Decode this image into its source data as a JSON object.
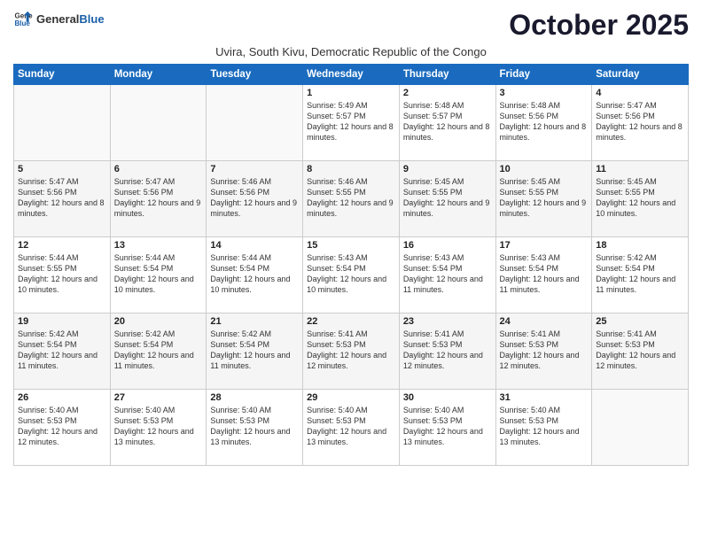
{
  "logo": {
    "general": "General",
    "blue": "Blue"
  },
  "title": "October 2025",
  "subtitle": "Uvira, South Kivu, Democratic Republic of the Congo",
  "headers": [
    "Sunday",
    "Monday",
    "Tuesday",
    "Wednesday",
    "Thursday",
    "Friday",
    "Saturday"
  ],
  "weeks": [
    [
      {
        "day": "",
        "sunrise": "",
        "sunset": "",
        "daylight": ""
      },
      {
        "day": "",
        "sunrise": "",
        "sunset": "",
        "daylight": ""
      },
      {
        "day": "",
        "sunrise": "",
        "sunset": "",
        "daylight": ""
      },
      {
        "day": "1",
        "sunrise": "Sunrise: 5:49 AM",
        "sunset": "Sunset: 5:57 PM",
        "daylight": "Daylight: 12 hours and 8 minutes."
      },
      {
        "day": "2",
        "sunrise": "Sunrise: 5:48 AM",
        "sunset": "Sunset: 5:57 PM",
        "daylight": "Daylight: 12 hours and 8 minutes."
      },
      {
        "day": "3",
        "sunrise": "Sunrise: 5:48 AM",
        "sunset": "Sunset: 5:56 PM",
        "daylight": "Daylight: 12 hours and 8 minutes."
      },
      {
        "day": "4",
        "sunrise": "Sunrise: 5:47 AM",
        "sunset": "Sunset: 5:56 PM",
        "daylight": "Daylight: 12 hours and 8 minutes."
      }
    ],
    [
      {
        "day": "5",
        "sunrise": "Sunrise: 5:47 AM",
        "sunset": "Sunset: 5:56 PM",
        "daylight": "Daylight: 12 hours and 8 minutes."
      },
      {
        "day": "6",
        "sunrise": "Sunrise: 5:47 AM",
        "sunset": "Sunset: 5:56 PM",
        "daylight": "Daylight: 12 hours and 9 minutes."
      },
      {
        "day": "7",
        "sunrise": "Sunrise: 5:46 AM",
        "sunset": "Sunset: 5:56 PM",
        "daylight": "Daylight: 12 hours and 9 minutes."
      },
      {
        "day": "8",
        "sunrise": "Sunrise: 5:46 AM",
        "sunset": "Sunset: 5:55 PM",
        "daylight": "Daylight: 12 hours and 9 minutes."
      },
      {
        "day": "9",
        "sunrise": "Sunrise: 5:45 AM",
        "sunset": "Sunset: 5:55 PM",
        "daylight": "Daylight: 12 hours and 9 minutes."
      },
      {
        "day": "10",
        "sunrise": "Sunrise: 5:45 AM",
        "sunset": "Sunset: 5:55 PM",
        "daylight": "Daylight: 12 hours and 9 minutes."
      },
      {
        "day": "11",
        "sunrise": "Sunrise: 5:45 AM",
        "sunset": "Sunset: 5:55 PM",
        "daylight": "Daylight: 12 hours and 10 minutes."
      }
    ],
    [
      {
        "day": "12",
        "sunrise": "Sunrise: 5:44 AM",
        "sunset": "Sunset: 5:55 PM",
        "daylight": "Daylight: 12 hours and 10 minutes."
      },
      {
        "day": "13",
        "sunrise": "Sunrise: 5:44 AM",
        "sunset": "Sunset: 5:54 PM",
        "daylight": "Daylight: 12 hours and 10 minutes."
      },
      {
        "day": "14",
        "sunrise": "Sunrise: 5:44 AM",
        "sunset": "Sunset: 5:54 PM",
        "daylight": "Daylight: 12 hours and 10 minutes."
      },
      {
        "day": "15",
        "sunrise": "Sunrise: 5:43 AM",
        "sunset": "Sunset: 5:54 PM",
        "daylight": "Daylight: 12 hours and 10 minutes."
      },
      {
        "day": "16",
        "sunrise": "Sunrise: 5:43 AM",
        "sunset": "Sunset: 5:54 PM",
        "daylight": "Daylight: 12 hours and 11 minutes."
      },
      {
        "day": "17",
        "sunrise": "Sunrise: 5:43 AM",
        "sunset": "Sunset: 5:54 PM",
        "daylight": "Daylight: 12 hours and 11 minutes."
      },
      {
        "day": "18",
        "sunrise": "Sunrise: 5:42 AM",
        "sunset": "Sunset: 5:54 PM",
        "daylight": "Daylight: 12 hours and 11 minutes."
      }
    ],
    [
      {
        "day": "19",
        "sunrise": "Sunrise: 5:42 AM",
        "sunset": "Sunset: 5:54 PM",
        "daylight": "Daylight: 12 hours and 11 minutes."
      },
      {
        "day": "20",
        "sunrise": "Sunrise: 5:42 AM",
        "sunset": "Sunset: 5:54 PM",
        "daylight": "Daylight: 12 hours and 11 minutes."
      },
      {
        "day": "21",
        "sunrise": "Sunrise: 5:42 AM",
        "sunset": "Sunset: 5:54 PM",
        "daylight": "Daylight: 12 hours and 11 minutes."
      },
      {
        "day": "22",
        "sunrise": "Sunrise: 5:41 AM",
        "sunset": "Sunset: 5:53 PM",
        "daylight": "Daylight: 12 hours and 12 minutes."
      },
      {
        "day": "23",
        "sunrise": "Sunrise: 5:41 AM",
        "sunset": "Sunset: 5:53 PM",
        "daylight": "Daylight: 12 hours and 12 minutes."
      },
      {
        "day": "24",
        "sunrise": "Sunrise: 5:41 AM",
        "sunset": "Sunset: 5:53 PM",
        "daylight": "Daylight: 12 hours and 12 minutes."
      },
      {
        "day": "25",
        "sunrise": "Sunrise: 5:41 AM",
        "sunset": "Sunset: 5:53 PM",
        "daylight": "Daylight: 12 hours and 12 minutes."
      }
    ],
    [
      {
        "day": "26",
        "sunrise": "Sunrise: 5:40 AM",
        "sunset": "Sunset: 5:53 PM",
        "daylight": "Daylight: 12 hours and 12 minutes."
      },
      {
        "day": "27",
        "sunrise": "Sunrise: 5:40 AM",
        "sunset": "Sunset: 5:53 PM",
        "daylight": "Daylight: 12 hours and 13 minutes."
      },
      {
        "day": "28",
        "sunrise": "Sunrise: 5:40 AM",
        "sunset": "Sunset: 5:53 PM",
        "daylight": "Daylight: 12 hours and 13 minutes."
      },
      {
        "day": "29",
        "sunrise": "Sunrise: 5:40 AM",
        "sunset": "Sunset: 5:53 PM",
        "daylight": "Daylight: 12 hours and 13 minutes."
      },
      {
        "day": "30",
        "sunrise": "Sunrise: 5:40 AM",
        "sunset": "Sunset: 5:53 PM",
        "daylight": "Daylight: 12 hours and 13 minutes."
      },
      {
        "day": "31",
        "sunrise": "Sunrise: 5:40 AM",
        "sunset": "Sunset: 5:53 PM",
        "daylight": "Daylight: 12 hours and 13 minutes."
      },
      {
        "day": "",
        "sunrise": "",
        "sunset": "",
        "daylight": ""
      }
    ]
  ]
}
